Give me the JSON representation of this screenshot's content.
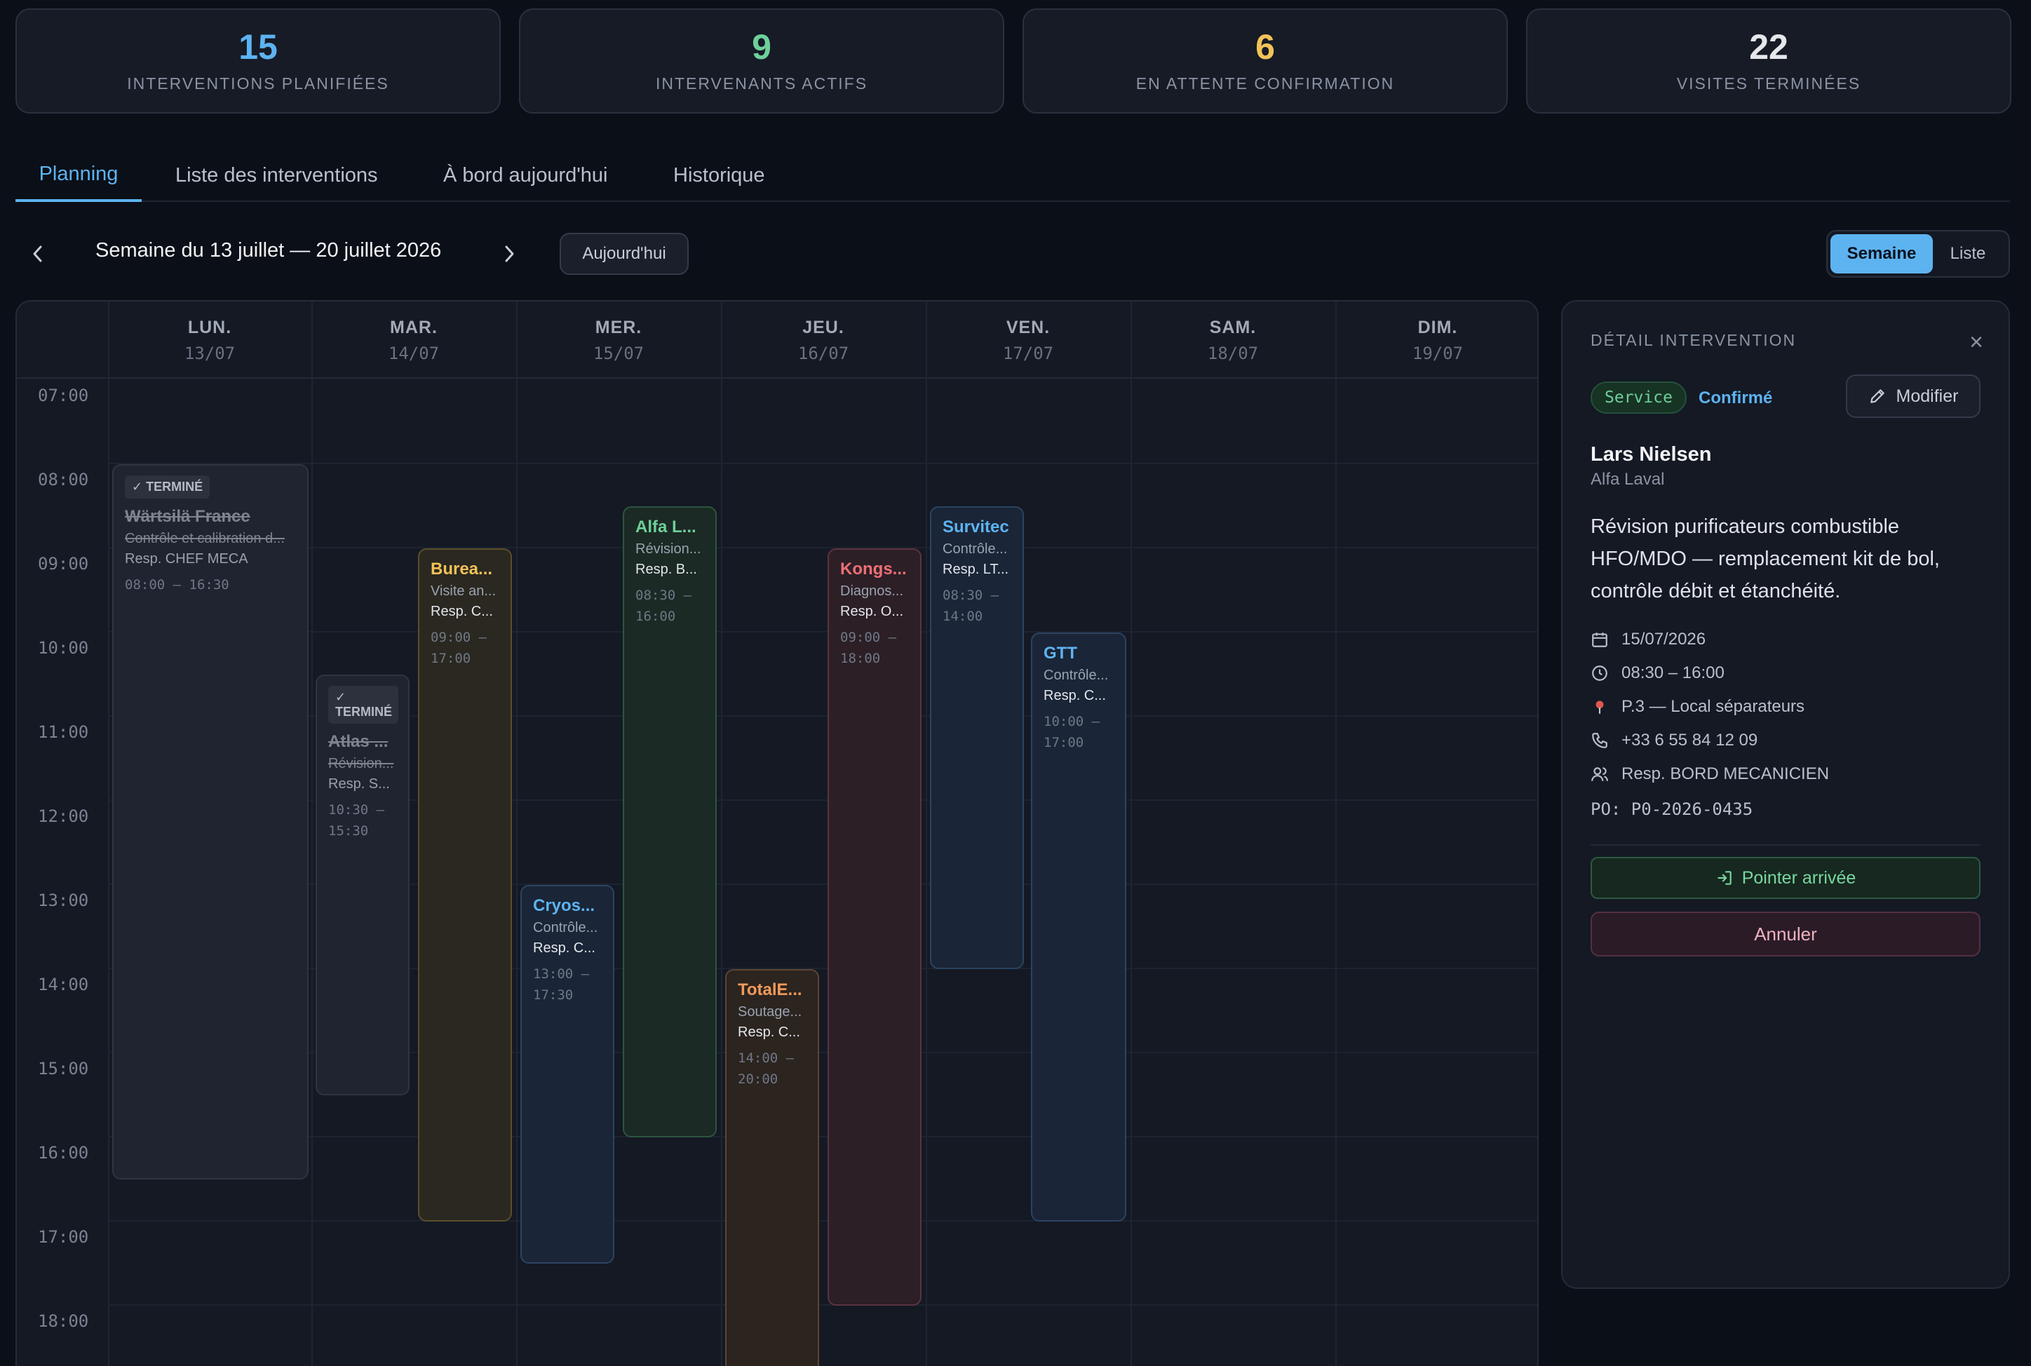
{
  "stats": [
    {
      "value": "15",
      "label": "INTERVENTIONS PLANIFIÉES",
      "color": "#5db3f0"
    },
    {
      "value": "9",
      "label": "INTERVENANTS ACTIFS",
      "color": "#6fd09a"
    },
    {
      "value": "6",
      "label": "EN ATTENTE CONFIRMATION",
      "color": "#f3c257"
    },
    {
      "value": "22",
      "label": "VISITES TERMINÉES",
      "color": "#e5e7eb"
    }
  ],
  "tabs": [
    "Planning",
    "Liste des interventions",
    "À bord aujourd'hui",
    "Historique"
  ],
  "active_tab": "Planning",
  "week": {
    "label": "Semaine du 13 juillet — 20 juillet 2026",
    "today_button": "Aujourd'hui",
    "view_week": "Semaine",
    "view_list": "Liste",
    "active_view": "Semaine"
  },
  "calendar": {
    "days": [
      {
        "name": "LUN.",
        "date": "13/07"
      },
      {
        "name": "MAR.",
        "date": "14/07"
      },
      {
        "name": "MER.",
        "date": "15/07"
      },
      {
        "name": "JEU.",
        "date": "16/07"
      },
      {
        "name": "VEN.",
        "date": "17/07"
      },
      {
        "name": "SAM.",
        "date": "18/07"
      },
      {
        "name": "DIM.",
        "date": "19/07"
      }
    ],
    "hours": [
      "07:00",
      "08:00",
      "09:00",
      "10:00",
      "11:00",
      "12:00",
      "13:00",
      "14:00",
      "15:00",
      "16:00",
      "17:00",
      "18:00"
    ],
    "events": [
      {
        "title": "Wärtsilä France",
        "desc": "Contrôle et calibration d...",
        "resp": "Resp. CHEF MECA",
        "time": "08:00 – 16:30",
        "badge": "✓ TERMINÉ",
        "done": true
      },
      {
        "title": "Atlas ...",
        "desc": "Révision...",
        "resp": "Resp. S...",
        "time": "10:30 – 15:30",
        "badge": "✓ TERMINÉ",
        "done": true
      },
      {
        "title": "Burea...",
        "desc": "Visite an...",
        "resp": "Resp. C...",
        "time": "09:00 – 17:00",
        "color": "#f3c257",
        "done": false
      },
      {
        "title": "Cryos...",
        "desc": "Contrôle...",
        "resp": "Resp. C...",
        "time": "13:00 – 17:30",
        "color": "#5db3f0",
        "done": false
      },
      {
        "title": "Alfa L...",
        "desc": "Révision...",
        "resp": "Resp. B...",
        "time": "08:30 – 16:00",
        "color": "#6fd09a",
        "done": false
      },
      {
        "title": "TotalE...",
        "desc": "Soutage...",
        "resp": "Resp. C...",
        "time": "14:00 – 20:00",
        "color": "#f39a5b",
        "done": false
      },
      {
        "title": "Kongs...",
        "desc": "Diagnos...",
        "resp": "Resp. O...",
        "time": "09:00 – 18:00",
        "color": "#ef6f76",
        "done": false
      },
      {
        "title": "Survitec",
        "desc": "Contrôle...",
        "resp": "Resp. LT...",
        "time": "08:30 – 14:00",
        "color": "#5db3f0",
        "done": false
      },
      {
        "title": "GTT",
        "desc": "Contrôle...",
        "resp": "Resp. C...",
        "time": "10:00 – 17:00",
        "color": "#5db3f0",
        "done": false
      }
    ]
  },
  "detail": {
    "title": "DÉTAIL INTERVENTION",
    "close": "×",
    "tag": "Service",
    "status": "Confirmé",
    "edit_button": "Modifier",
    "name": "Lars Nielsen",
    "company": "Alfa Laval",
    "description": "Révision purificateurs combustible HFO/MDO — remplacement kit de bol, contrôle débit et étanchéité.",
    "date": "15/07/2026",
    "time": "08:30 – 16:00",
    "location": "P.3 — Local séparateurs",
    "phone": "+33 6 55 84 12 09",
    "responsible": "Resp. BORD MECANICIEN",
    "po": "PO: P0-2026-0435",
    "arrive_button": "Pointer arrivée",
    "cancel_button": "Annuler"
  }
}
